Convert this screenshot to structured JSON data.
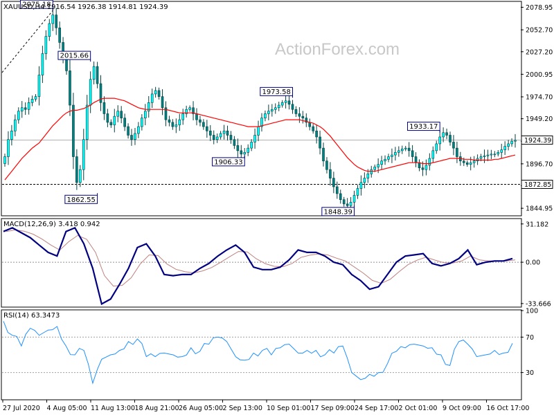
{
  "chart_data": {
    "type": "candlestick",
    "symbol": "XAUUSD",
    "timeframe": "H4",
    "header_text": "XAUUSD,H4  1916.54 1926.38 1914.81 1924.39",
    "watermark": "ActionForex.com",
    "colors": {
      "candle": "#00ffff",
      "candle_dark": "#008080",
      "ma": "#ff0000",
      "macd": "#000080",
      "signal": "#c08080",
      "rsi": "#1e90ff",
      "level_box": "#000080"
    },
    "price_ticks": [
      "2078.95",
      "2052.70",
      "2027.20",
      "2000.95",
      "1974.70",
      "1949.20",
      "1922.95",
      "1896.70",
      "1871.20",
      "1844.95"
    ],
    "price_ylim": [
      1837,
      2085
    ],
    "current_price": "1924.39",
    "support_level": "1872.85",
    "macd": {
      "label": "MACD(12,26,9) 3.418 0.942",
      "ticks": [
        "31.182",
        "0.00",
        "-33.666"
      ],
      "ylim": [
        -36,
        35
      ],
      "values": [
        25,
        28,
        24,
        20,
        14,
        8,
        5,
        25,
        28,
        15,
        -5,
        -34,
        -30,
        -18,
        -5,
        12,
        15,
        5,
        -10,
        -11,
        -10,
        -10,
        -5,
        -1,
        5,
        10,
        14,
        8,
        -4,
        -6,
        -6,
        -4,
        2,
        10,
        8,
        8,
        5,
        0,
        -2,
        -10,
        -15,
        -22,
        -20,
        -10,
        0,
        5,
        6,
        7,
        -1,
        -3,
        -1,
        3,
        10,
        -2,
        0,
        1,
        1,
        3
      ]
    },
    "rsi": {
      "label": "RSI(14) 63.3473",
      "ticks": [
        "100",
        "70",
        "30",
        "0"
      ],
      "levels": [
        70,
        30
      ],
      "values": [
        88,
        72,
        60,
        80,
        72,
        78,
        82,
        60,
        50,
        55,
        18,
        45,
        50,
        55,
        65,
        68,
        48,
        48,
        52,
        50,
        48,
        58,
        54,
        62,
        70,
        65,
        48,
        44,
        52,
        55,
        50,
        58,
        62,
        52,
        55,
        55,
        50,
        52,
        60,
        30,
        22,
        28,
        30,
        40,
        54,
        58,
        62,
        60,
        58,
        50,
        38,
        65,
        62,
        48,
        50,
        55,
        52,
        63
      ]
    },
    "annotations": [
      {
        "label": "2075.18",
        "t": 14,
        "price": 2075.18,
        "side": "top"
      },
      {
        "label": "2015.66",
        "t": 25,
        "price": 2015.66,
        "side": "top"
      },
      {
        "label": "1862.55",
        "t": 27,
        "price": 1862.55,
        "side": "bottom"
      },
      {
        "label": "1906.33",
        "t": 70,
        "price": 1906.33,
        "side": "bottom"
      },
      {
        "label": "1973.58",
        "t": 84,
        "price": 1973.58,
        "side": "top"
      },
      {
        "label": "1848.39",
        "t": 102,
        "price": 1848.39,
        "side": "bottom"
      },
      {
        "label": "1933.17",
        "t": 127,
        "price": 1933.17,
        "side": "top"
      }
    ],
    "x_labels": [
      "27 Jul 2020",
      "4 Aug 05:00",
      "11 Aug 13:00",
      "18 Aug 21:00",
      "26 Aug 05:00",
      "2 Sep 13:00",
      "10 Sep 01:00",
      "17 Sep 09:00",
      "24 Sep 17:00",
      "2 Oct 01:00",
      "9 Oct 09:00",
      "16 Oct 17:00"
    ],
    "closes": [
      1905,
      1925,
      1935,
      1948,
      1958,
      1962,
      1960,
      1968,
      1972,
      1975,
      2000,
      2025,
      2045,
      2060,
      2070,
      2055,
      2038,
      2020,
      2005,
      1965,
      1905,
      1875,
      1890,
      1925,
      1965,
      1995,
      2010,
      1990,
      1968,
      1955,
      1945,
      1942,
      1952,
      1958,
      1950,
      1940,
      1930,
      1925,
      1932,
      1940,
      1950,
      1958,
      1968,
      1978,
      1982,
      1975,
      1962,
      1948,
      1945,
      1940,
      1942,
      1948,
      1955,
      1960,
      1962,
      1955,
      1948,
      1945,
      1940,
      1935,
      1930,
      1925,
      1928,
      1932,
      1935,
      1930,
      1925,
      1918,
      1912,
      1908,
      1910,
      1915,
      1922,
      1930,
      1940,
      1950,
      1955,
      1958,
      1960,
      1962,
      1965,
      1968,
      1970,
      1966,
      1960,
      1955,
      1952,
      1950,
      1945,
      1940,
      1935,
      1928,
      1915,
      1900,
      1890,
      1880,
      1870,
      1862,
      1855,
      1850,
      1848,
      1852,
      1860,
      1868,
      1875,
      1880,
      1885,
      1890,
      1893,
      1896,
      1900,
      1902,
      1905,
      1907,
      1910,
      1912,
      1914,
      1915,
      1912,
      1905,
      1898,
      1892,
      1890,
      1895,
      1903,
      1912,
      1920,
      1928,
      1933,
      1930,
      1922,
      1915,
      1905,
      1900,
      1898,
      1896,
      1898,
      1900,
      1903,
      1905,
      1906,
      1907,
      1908,
      1908,
      1910,
      1913,
      1917,
      1920,
      1923,
      1924
    ],
    "ma": [
      1878,
      1883,
      1888,
      1893,
      1898,
      1903,
      1907,
      1911,
      1915,
      1918,
      1921,
      1926,
      1931,
      1936,
      1941,
      1945,
      1949,
      1953,
      1956,
      1958,
      1959,
      1959,
      1960,
      1961,
      1963,
      1965,
      1968,
      1970,
      1972,
      1973,
      1973,
      1973,
      1973,
      1972,
      1971,
      1970,
      1968,
      1966,
      1964,
      1962,
      1961,
      1960,
      1960,
      1960,
      1960,
      1960,
      1960,
      1960,
      1959,
      1958,
      1957,
      1956,
      1956,
      1956,
      1956,
      1956,
      1955,
      1954,
      1953,
      1952,
      1951,
      1950,
      1949,
      1948,
      1947,
      1946,
      1945,
      1944,
      1943,
      1942,
      1941,
      1940,
      1940,
      1940,
      1940,
      1941,
      1942,
      1943,
      1944,
      1945,
      1946,
      1947,
      1948,
      1948,
      1948,
      1948,
      1948,
      1947,
      1946,
      1945,
      1944,
      1942,
      1940,
      1937,
      1933,
      1929,
      1924,
      1919,
      1914,
      1909,
      1904,
      1900,
      1896,
      1893,
      1891,
      1889,
      1888,
      1888,
      1888,
      1889,
      1890,
      1891,
      1892,
      1893,
      1894,
      1895,
      1896,
      1897,
      1898,
      1898,
      1898,
      1898,
      1897,
      1897,
      1897,
      1898,
      1899,
      1900,
      1901,
      1902,
      1903,
      1903,
      1903,
      1903,
      1902,
      1902,
      1902,
      1901,
      1901,
      1901,
      1901,
      1901,
      1901,
      1902,
      1902,
      1903,
      1904,
      1905,
      1906,
      1907
    ]
  }
}
